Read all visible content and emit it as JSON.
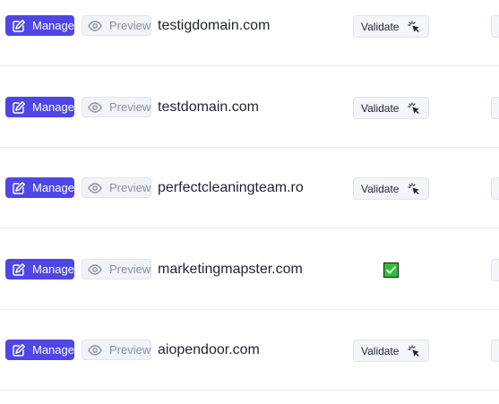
{
  "actions": {
    "manage_label": "Manage",
    "preview_label": "Preview",
    "validate_label": "Validate"
  },
  "colors": {
    "manage_bg": "#4f46e5",
    "validated_check": "#2fbf35"
  },
  "rows": [
    {
      "domain": "testigdomain.com",
      "status": "validate"
    },
    {
      "domain": "testdomain.com",
      "status": "validate"
    },
    {
      "domain": "perfectcleaningteam.ro",
      "status": "validate"
    },
    {
      "domain": "marketingmapster.com",
      "status": "validated"
    },
    {
      "domain": "aiopendoor.com",
      "status": "validate"
    }
  ]
}
